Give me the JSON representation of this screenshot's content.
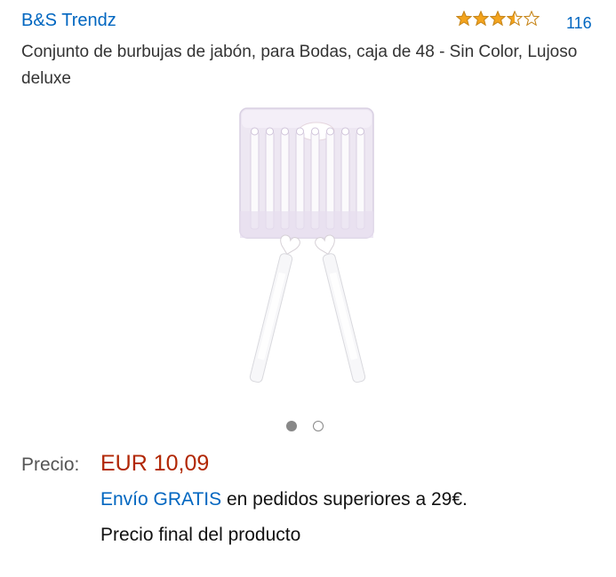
{
  "header": {
    "brand": "B&S Trendz",
    "rating": {
      "stars": 3.5,
      "out_of": 5,
      "count": "116"
    }
  },
  "product": {
    "title": "Conjunto de burbujas de jabón, para Bodas, caja de 48 - Sin Color, Lujoso deluxe",
    "image": {
      "icon": "bubble-wands-box-image",
      "current_index": 1,
      "total": 2
    }
  },
  "pricing": {
    "label": "Precio:",
    "value": "EUR 10,09",
    "shipping_link": "Envío GRATIS",
    "shipping_rest": " en pedidos superiores a 29€.",
    "final_note": "Precio final del producto"
  },
  "colors": {
    "link": "#0066c0",
    "price": "#B12704",
    "star": "#F4A41D"
  }
}
